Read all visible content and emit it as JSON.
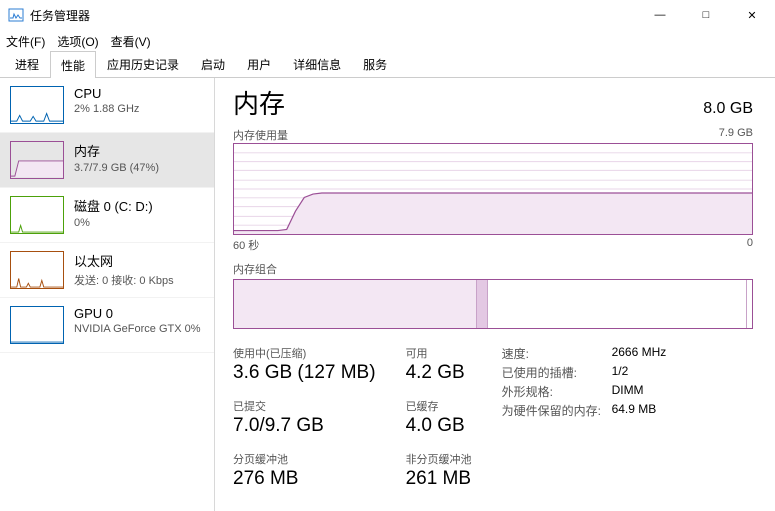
{
  "window": {
    "title": "任务管理器"
  },
  "menus": [
    "文件(F)",
    "选项(O)",
    "查看(V)"
  ],
  "tabs": [
    "进程",
    "性能",
    "应用历史记录",
    "启动",
    "用户",
    "详细信息",
    "服务"
  ],
  "active_tab": 1,
  "sidebar": [
    {
      "title": "CPU",
      "sub": "2% 1.88 GHz",
      "kind": "cpu"
    },
    {
      "title": "内存",
      "sub": "3.7/7.9 GB (47%)",
      "kind": "mem",
      "selected": true
    },
    {
      "title": "磁盘 0 (C: D:)",
      "sub": "0%",
      "kind": "disk"
    },
    {
      "title": "以太网",
      "sub": "发送: 0 接收: 0 Kbps",
      "kind": "eth"
    },
    {
      "title": "GPU 0",
      "sub": "NVIDIA GeForce GTX 0%",
      "kind": "gpu"
    }
  ],
  "main": {
    "heading": "内存",
    "total": "8.0 GB",
    "usage_chart_label": "内存使用量",
    "usage_chart_max": "7.9 GB",
    "xaxis_left": "60 秒",
    "xaxis_right": "0",
    "composition_label": "内存组合",
    "stats_col1": [
      {
        "lbl": "使用中(已压缩)",
        "val": "3.6 GB (127 MB)"
      },
      {
        "lbl": "已提交",
        "val": "7.0/9.7 GB"
      },
      {
        "lbl": "分页缓冲池",
        "val": "276 MB"
      }
    ],
    "stats_col2": [
      {
        "lbl": "可用",
        "val": "4.2 GB"
      },
      {
        "lbl": "已缓存",
        "val": "4.0 GB"
      },
      {
        "lbl": "非分页缓冲池",
        "val": "261 MB"
      }
    ],
    "info": [
      {
        "k": "速度:",
        "v": "2666 MHz"
      },
      {
        "k": "已使用的插槽:",
        "v": "1/2"
      },
      {
        "k": "外形规格:",
        "v": "DIMM"
      },
      {
        "k": "为硬件保留的内存:",
        "v": "64.9 MB"
      }
    ]
  },
  "chart_data": {
    "type": "area",
    "title": "内存使用量",
    "xlabel": "秒",
    "ylabel": "GB",
    "x_range": [
      60,
      0
    ],
    "ylim": [
      0,
      7.9
    ],
    "series": [
      {
        "name": "使用中",
        "values_gb": [
          0.3,
          0.3,
          0.3,
          0.3,
          0.3,
          0.3,
          0.4,
          2.0,
          3.2,
          3.5,
          3.6,
          3.6,
          3.6,
          3.6,
          3.6,
          3.6,
          3.6,
          3.6,
          3.6,
          3.6,
          3.6,
          3.6,
          3.6,
          3.6,
          3.6,
          3.6,
          3.6,
          3.6,
          3.6,
          3.6,
          3.6,
          3.6,
          3.6,
          3.6,
          3.6,
          3.6,
          3.6,
          3.6,
          3.6,
          3.6,
          3.6,
          3.6,
          3.6,
          3.6,
          3.6,
          3.6,
          3.6,
          3.6,
          3.6,
          3.6,
          3.6,
          3.6,
          3.6,
          3.6,
          3.6,
          3.6,
          3.6,
          3.6,
          3.6,
          3.6
        ]
      }
    ],
    "composition": {
      "in_use_pct": 47,
      "modified_pct": 2,
      "standby_pct": 50,
      "free_pct": 1
    }
  }
}
